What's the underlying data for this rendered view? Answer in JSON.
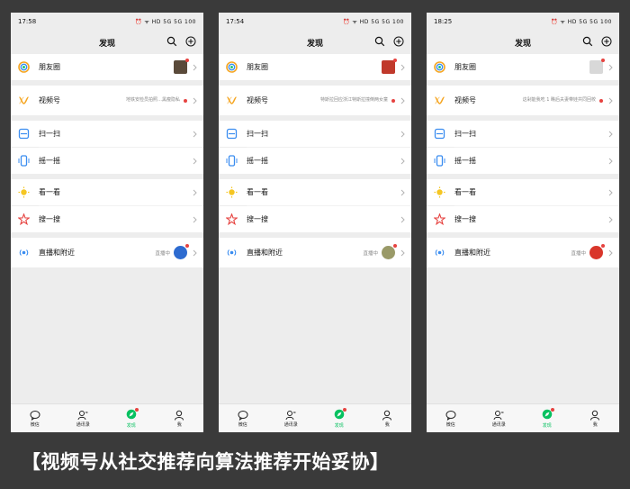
{
  "phones": [
    {
      "time": "17:58",
      "status_icons": "⏰ ᯤ HD 5G 5G 100",
      "title": "发现",
      "rows": {
        "moments": {
          "label": "朋友圈"
        },
        "channels": {
          "label": "视频号",
          "desc": "地铁安检员拍照…黑瘦隐私"
        },
        "scan": {
          "label": "扫一扫"
        },
        "shake": {
          "label": "摇一摇"
        },
        "topstories": {
          "label": "看一看"
        },
        "search": {
          "label": "搜一搜"
        },
        "nearby": {
          "label": "直播和附近",
          "live": "直播中"
        }
      },
      "avatar_colors": {
        "moments": "#5a4a3a",
        "nearby": "#2d6bd0"
      }
    },
    {
      "time": "17:54",
      "status_icons": "⏰ ᯤ HD 5G 5G 100",
      "title": "发现",
      "rows": {
        "moments": {
          "label": "朋友圈"
        },
        "channels": {
          "label": "视频号",
          "desc": "特斯拉回应浙江特斯拉撞倒两女童"
        },
        "scan": {
          "label": "扫一扫"
        },
        "shake": {
          "label": "摇一摇"
        },
        "topstories": {
          "label": "看一看"
        },
        "search": {
          "label": "搜一搜"
        },
        "nearby": {
          "label": "直播和附近",
          "live": "直播中"
        }
      },
      "avatar_colors": {
        "moments": "#c0392b",
        "nearby": "#9a9a68"
      }
    },
    {
      "time": "18:25",
      "status_icons": "⏰ ᯤ HD 5G 5G 100",
      "title": "发现",
      "rows": {
        "moments": {
          "label": "朋友圈"
        },
        "channels": {
          "label": "视频号",
          "desc": "这剁能我吃 1 瞧后夫妻带娃共同回校"
        },
        "scan": {
          "label": "扫一扫"
        },
        "shake": {
          "label": "摇一摇"
        },
        "topstories": {
          "label": "看一看"
        },
        "search": {
          "label": "搜一搜"
        },
        "nearby": {
          "label": "直播和附近",
          "live": "直播中"
        }
      },
      "avatar_colors": {
        "moments": "#d8d8d8",
        "nearby": "#d9362b"
      }
    }
  ],
  "tabs": [
    "微信",
    "通讯录",
    "发现",
    "我"
  ],
  "caption": "【视频号从社交推荐向算法推荐开始妥协】",
  "colors": {
    "accent": "#07c160",
    "badge": "#e64340",
    "background": "#3a3a3a"
  }
}
